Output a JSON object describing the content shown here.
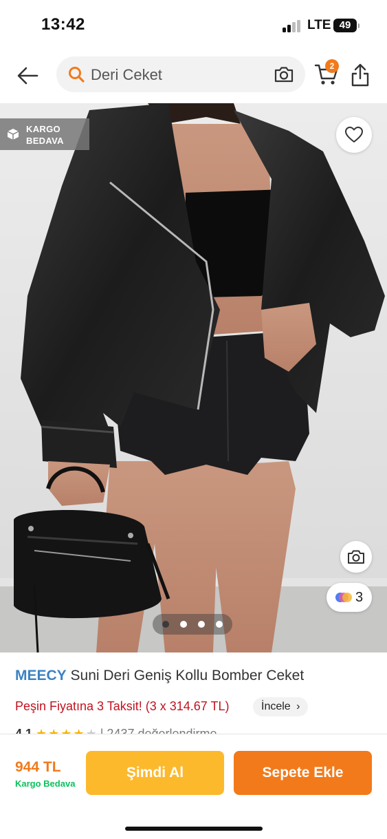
{
  "status_bar": {
    "time": "13:42",
    "network": "LTE",
    "battery": "49"
  },
  "header": {
    "search_value": "Deri Ceket",
    "cart_count": "2"
  },
  "product": {
    "badge_line1": "KARGO",
    "badge_line2": "BEDAVA",
    "ar_count": "3",
    "brand": "MEECY",
    "name": "Suni Deri Geniş Kollu Bomber Ceket",
    "installment": "Peşin Fiyatına 3 Taksit! (3 x 314.67 TL)",
    "installment_button": "İncele",
    "rating": "4.1",
    "stars_filled": 4,
    "review_text": "| 2437 değerlendirme"
  },
  "bottom_bar": {
    "price": "944 TL",
    "shipping": "Kargo Bedava",
    "buy_now": "Şimdi Al",
    "add_to_cart": "Sepete Ekle"
  },
  "colors": {
    "accent_orange": "#f27a1a",
    "buy_yellow": "#fdb92c",
    "brand_blue": "#3b82c4",
    "installment_red": "#c1121f",
    "shipping_green": "#0bc15c"
  },
  "icons": [
    "back-arrow-icon",
    "search-icon",
    "camera-icon",
    "cart-icon",
    "share-icon",
    "box-icon",
    "heart-icon",
    "visual-search-icon",
    "chevron-right-icon"
  ]
}
